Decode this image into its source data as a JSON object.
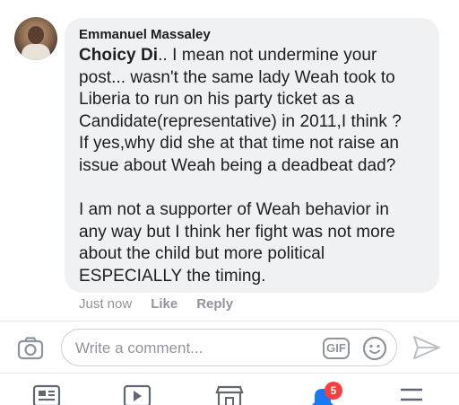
{
  "comment": {
    "author": "Emmanuel Massaley",
    "mention": "Choicy Di",
    "text_after_mention": ".. I mean not undermine your\npost... wasn't the same lady Weah took to\nLiberia to run on his party ticket as a\nCandidate(representative) in   2011,I think ?\nIf yes,why did she at that time not raise an\nissue about Weah being a deadbeat dad?\n\nI am not a supporter of Weah behavior in\nany way but I think her fight was not more\nabout the child but more political\nESPECIALLY the timing."
  },
  "meta": {
    "time": "Just now",
    "like_label": "Like",
    "reply_label": "Reply"
  },
  "composer": {
    "placeholder": "Write a comment...",
    "gif_label": "GIF"
  },
  "nav": {
    "notifications_badge": "5"
  },
  "colors": {
    "badge": "#fa3e3e",
    "notifications_icon": "#1877f2",
    "muted": "#90949c"
  }
}
